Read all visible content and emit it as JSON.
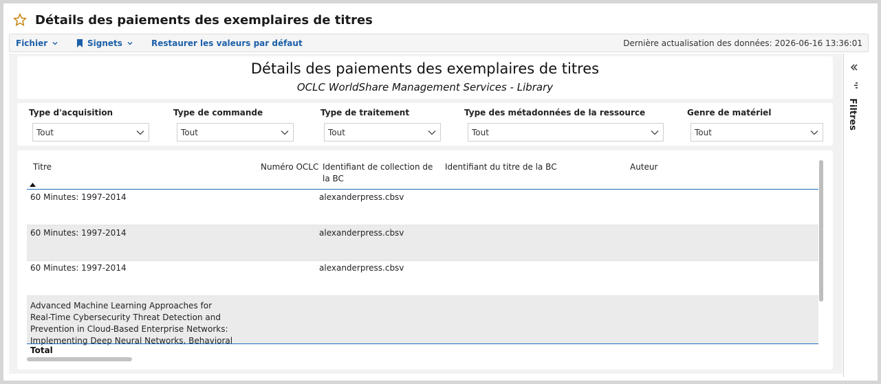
{
  "page": {
    "title": "Détails des paiements des exemplaires de titres"
  },
  "toolbar": {
    "file_label": "Fichier",
    "bookmarks_label": "Signets",
    "restore_label": "Restaurer les valeurs par défaut",
    "last_update": "Dernière actualisation des données: 2026-06-16 13:36:01"
  },
  "report": {
    "title": "Détails des paiements des exemplaires de titres",
    "subtitle": "OCLC WorldShare Management Services - Library"
  },
  "filters": [
    {
      "label": "Type d'acquisition",
      "value": "Tout"
    },
    {
      "label": "Type de commande",
      "value": "Tout"
    },
    {
      "label": "Type de traitement",
      "value": "Tout"
    },
    {
      "label": "Type des métadonnées de la ressource",
      "value": "Tout"
    },
    {
      "label": "Genre de matériel",
      "value": "Tout"
    }
  ],
  "table": {
    "columns": [
      {
        "label": "Titre",
        "sorted": "ascending"
      },
      {
        "label": "Numéro OCLC"
      },
      {
        "label": "Identifiant de collection de la BC"
      },
      {
        "label": "Identifiant du titre de la BC"
      },
      {
        "label": "Auteur"
      }
    ],
    "rows": [
      {
        "title": "60 Minutes: 1997-2014",
        "collection_id": "alexanderpress.cbsv"
      },
      {
        "title": "60 Minutes: 1997-2014",
        "collection_id": "alexanderpress.cbsv"
      },
      {
        "title": "60 Minutes: 1997-2014",
        "collection_id": "alexanderpress.cbsv"
      },
      {
        "title_lines": [
          "Advanced Machine Learning Approaches for",
          "Real-Time Cybersecurity Threat Detection and",
          "Prevention in Cloud-Based Enterprise Networks:",
          "Implementing Deep Neural Networks, Behavioral"
        ]
      }
    ],
    "total_label": "Total"
  },
  "side_panel": {
    "label": "Filtres"
  },
  "icons": [
    "star-icon",
    "chevron-down-icon",
    "bookmark-icon",
    "double-chevron-left-icon",
    "filter-icon",
    "sort-ascending-icon"
  ],
  "colors": {
    "accent": "#1c5fa8",
    "star": "#c98a1a",
    "header_line": "#1c6ec2",
    "row_shade": "#ebebeb"
  }
}
